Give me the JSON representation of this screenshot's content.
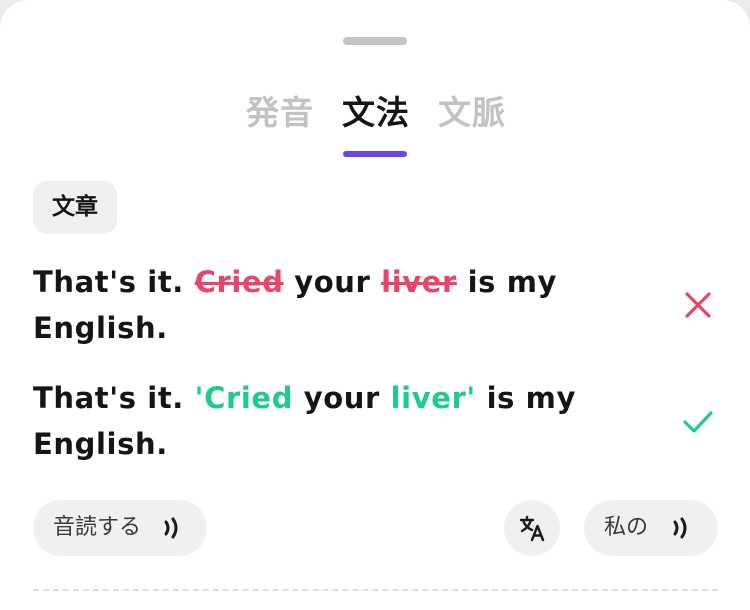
{
  "tabs": [
    {
      "label": "発音",
      "active": false
    },
    {
      "label": "文法",
      "active": true
    },
    {
      "label": "文脈",
      "active": false
    }
  ],
  "section_chip": "文章",
  "original_sentence": {
    "part1": "That's it. ",
    "struck1": "Cried",
    "part2": " your ",
    "struck2": "liver",
    "part3": " is my English."
  },
  "corrected_sentence": {
    "part1": "That's it. ",
    "good1": "'Cried",
    "part2": " your ",
    "good2": "liver'",
    "part3": " is my English."
  },
  "actions": {
    "read_aloud": "音読する",
    "my_recording": "私の"
  },
  "icons": {
    "wrong": "x-icon",
    "correct": "check-icon",
    "sound": "sound-wave-icon",
    "translate": "translate-icon"
  },
  "colors": {
    "accent": "#6b46e5",
    "error": "#e8456b",
    "success": "#1fcb8a"
  }
}
